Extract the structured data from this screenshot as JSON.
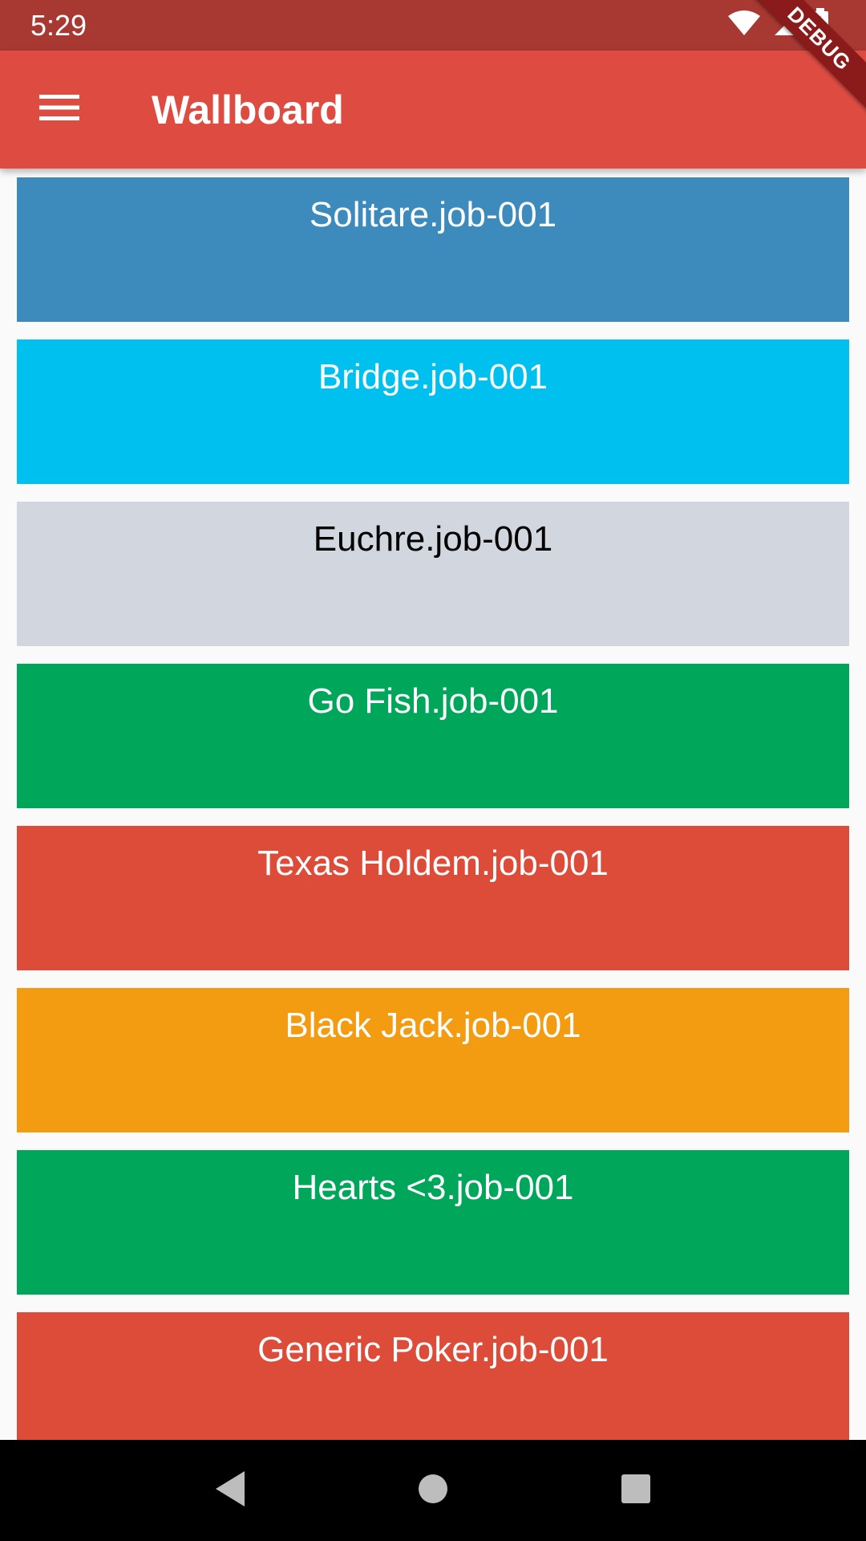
{
  "status_bar": {
    "time": "5:29",
    "icons": [
      "wifi-icon",
      "cell-signal-icon",
      "battery-charging-icon"
    ]
  },
  "app_bar": {
    "title": "Wallboard",
    "menu_icon": "hamburger-menu-icon",
    "background": "#dd4b41"
  },
  "debug_banner": "DEBUG",
  "jobs": [
    {
      "label": "Solitare.job-001",
      "color": "#3d8bbd",
      "text_color": "#ffffff"
    },
    {
      "label": "Bridge.job-001",
      "color": "#00c0ef",
      "text_color": "#ffffff"
    },
    {
      "label": "Euchre.job-001",
      "color": "#d2d6de",
      "text_color": "#000000"
    },
    {
      "label": "Go Fish.job-001",
      "color": "#00a65a",
      "text_color": "#ffffff"
    },
    {
      "label": "Texas Holdem.job-001",
      "color": "#dd4b39",
      "text_color": "#ffffff"
    },
    {
      "label": "Black Jack.job-001",
      "color": "#f39c12",
      "text_color": "#ffffff"
    },
    {
      "label": "Hearts <3.job-001",
      "color": "#00a65a",
      "text_color": "#ffffff"
    },
    {
      "label": "Generic Poker.job-001",
      "color": "#dd4b39",
      "text_color": "#ffffff"
    }
  ],
  "nav_bar": {
    "buttons": [
      "back-icon",
      "home-icon",
      "recents-icon"
    ]
  }
}
